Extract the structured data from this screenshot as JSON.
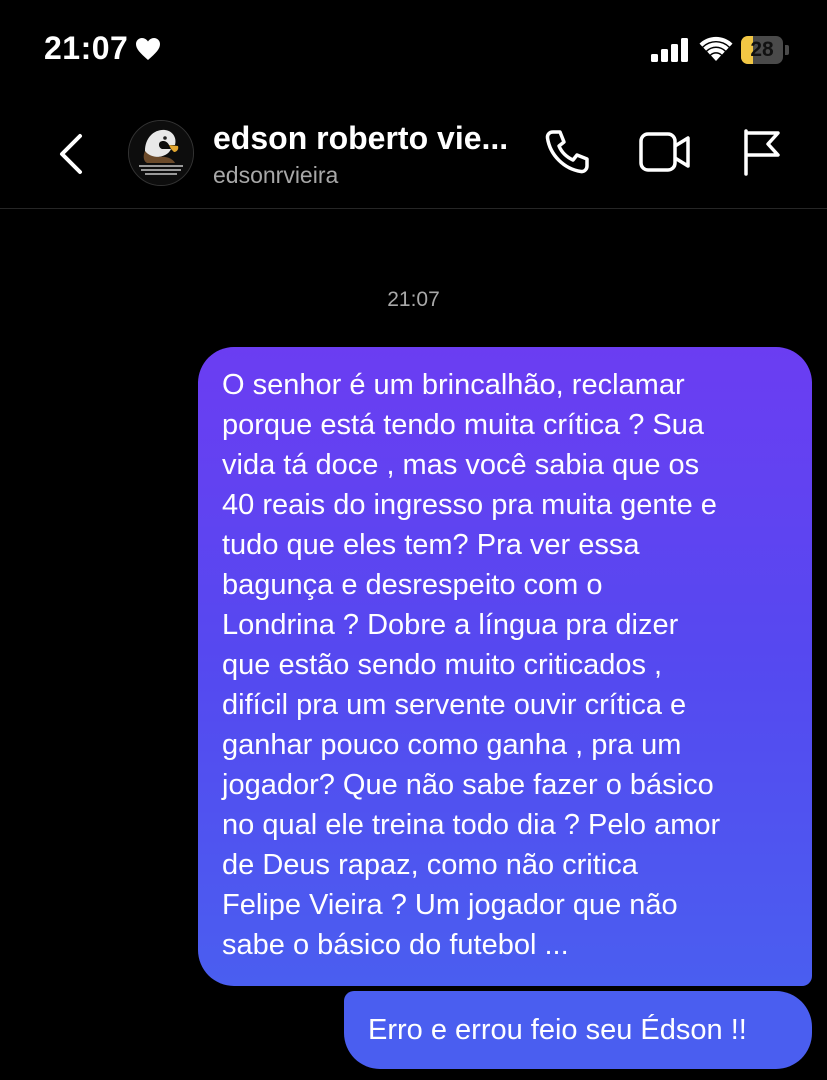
{
  "status_bar": {
    "time": "21:07",
    "heart_icon": "heart-icon",
    "signal_icon": "signal-icon",
    "wifi_icon": "wifi-icon",
    "battery_level": "28",
    "battery_color": "#f2c744"
  },
  "header": {
    "back_icon": "chevron-left-icon",
    "contact_name": "edson roberto vie...",
    "contact_username": "edsonrvieira",
    "call_icon": "phone-icon",
    "video_icon": "video-camera-icon",
    "report_icon": "flag-icon"
  },
  "chat": {
    "timestamp": "21:07",
    "accent_gradient": [
      "#6b3df2",
      "#4a5ef0"
    ],
    "messages": [
      {
        "sender": "me",
        "text": "O senhor é um brincalhão, reclamar\nporque está tendo muita crítica ? Sua\nvida tá doce , mas você sabia que os\n40 reais do ingresso pra muita gente e\ntudo que eles tem? Pra ver essa\nbagunça e desrespeito com o\nLondrina ? Dobre a língua pra dizer\nque estão sendo muito criticados ,\ndifícil pra um servente ouvir crítica e\nganhar pouco como ganha , pra um\njogador? Que não sabe fazer o básico\nno qual ele treina todo dia ? Pelo amor\nde Deus rapaz, como não critica\nFelipe Vieira ? Um jogador que não\nsabe o básico do futebol ..."
      },
      {
        "sender": "me",
        "text": "Erro e errou feio seu Édson !!"
      }
    ]
  }
}
